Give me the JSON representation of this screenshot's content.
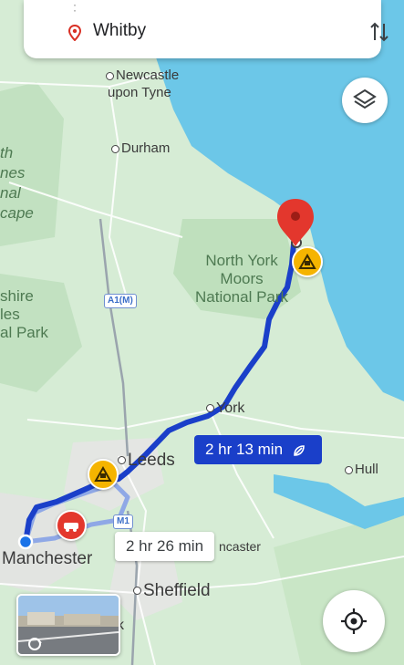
{
  "search": {
    "destination": "Whitby"
  },
  "map_labels": {
    "newcastle": "Newcastle\nupon Tyne",
    "durham": "Durham",
    "north_york_moors": "North York\nMoors\nNational Park",
    "york": "York",
    "leeds": "Leeds",
    "hull": "Hull",
    "manchester": "Manchester",
    "sheffield": "Sheffield",
    "doncaster": "ncaster",
    "left_park_top": "th\nnes\nnal\ncape",
    "left_park_bottom": "shire\nles\nal Park",
    "road_a1m": "A1(M)",
    "road_m1": "M1",
    "k_fragment": "k"
  },
  "routes": {
    "primary_time": "2 hr 13 min",
    "alternative_time": "2 hr 26 min"
  },
  "colors": {
    "route_primary": "#1a3fc9",
    "route_alt": "#8fa8e6",
    "sea": "#6cc7e8",
    "land": "#d6ecd5",
    "hazard": "#f5b400",
    "pin": "#e3372d"
  }
}
